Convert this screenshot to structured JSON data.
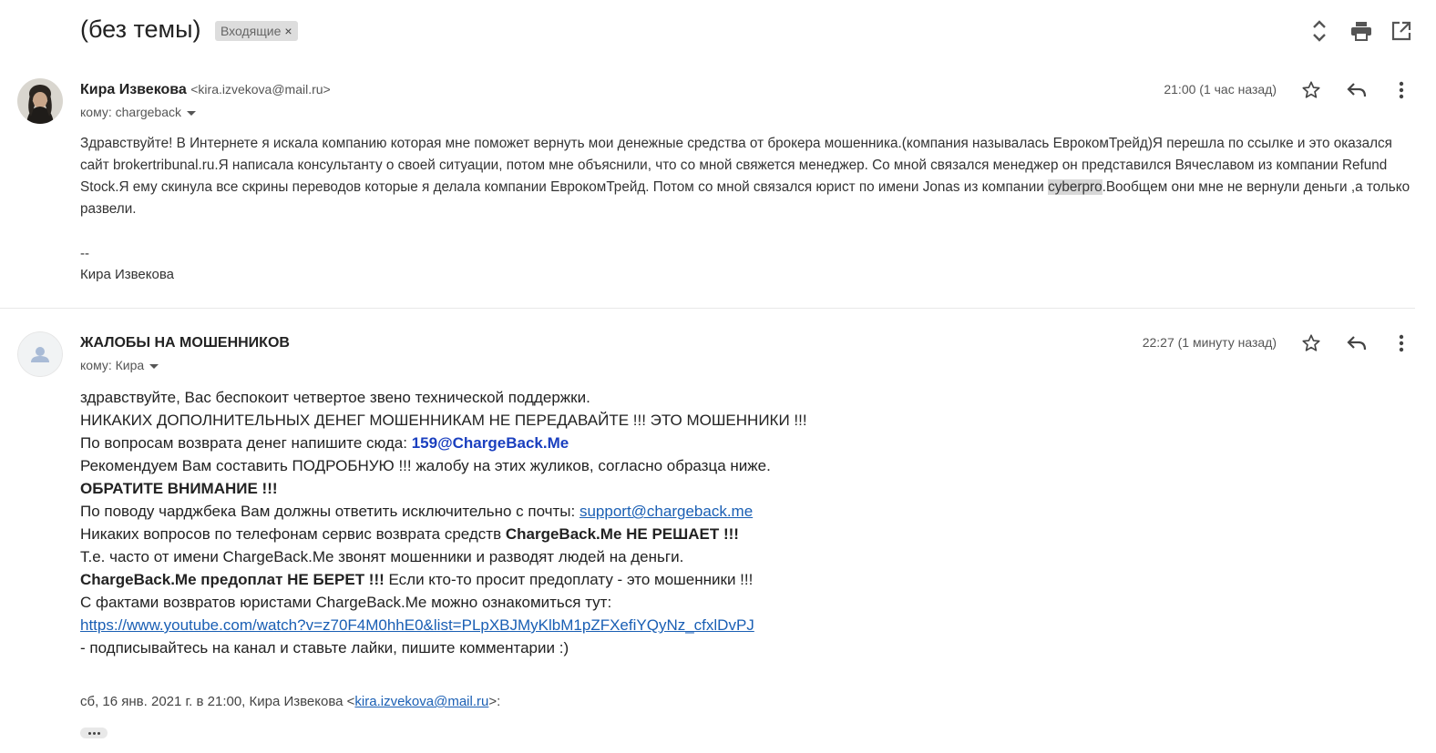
{
  "header": {
    "subject": "(без темы)",
    "label": "Входящие",
    "label_close": "×",
    "icons": [
      "expand-collapse-icon",
      "print-icon",
      "open-in-new-window-icon"
    ]
  },
  "message1": {
    "sender_name": "Кира Извекова",
    "sender_email": "<kira.izvekova@mail.ru>",
    "to": "кому: chargeback",
    "time": "21:00 (1 час назад)",
    "body_before": "Здравствуйте! В Интернете я искала компанию которая мне поможет вернуть мои денежные средства от брокера мошенника.(компания называлась ЕврокомТрейд)Я перешла по ссылке и это оказался сайт brokertribunal.ru.Я написала консультанту о своей ситуации, потом мне объяснили, что со мной свяжется менеджер. Со мной связался менеджер он представился Вячеславом из компании Refund Stock.Я ему скинула все скрины переводов которые я делала компании ЕврокомТрейд. Потом со мной связался юрист по имени Jonas из компании ",
    "body_highlight": "cyberpro",
    "body_after": ".Вообщем они мне не вернули деньги ,а только развели.",
    "sig_dash": "--",
    "sig_name": "Кира Извекова"
  },
  "message2": {
    "sender_name": "ЖАЛОБЫ НА МОШЕННИКОВ",
    "to": "кому: Кира",
    "time": "22:27 (1 минуту назад)",
    "l1": "здравствуйте, Вас беспокоит четвертое звено технической поддержки.",
    "l2": "НИКАКИХ ДОПОЛНИТЕЛЬНЫХ ДЕНЕГ МОШЕННИКАМ НЕ ПЕРЕДАВАЙТЕ !!! ЭТО МОШЕННИКИ !!!",
    "l3_text": "По вопросам возврата денег напишите сюда: ",
    "l3_email": "159@ChargeBack.Me",
    "l4": "Рекомендуем Вам составить ПОДРОБНУЮ !!! жалобу на этих жуликов, согласно образца ниже.",
    "l5": "ОБРАТИТЕ ВНИМАНИЕ !!!",
    "l6_text": "По поводу чарджбека Вам должны ответить исключительно с почты: ",
    "l6_link": "support@chargeback.me",
    "l7_text": "Никаких вопросов по телефонам сервис возврата средств ",
    "l7_bold": "ChargeBack.Me НЕ РЕШАЕТ !!!",
    "l8": "Т.е. часто от имени ChargeBack.Me звонят мошенники и разводят людей на деньги.",
    "l9_bold": "ChargeBack.Me предоплат НЕ БЕРЕТ !!!",
    "l9_text": " Если кто-то просит предоплату - это мошенники !!!",
    "l10": "С фактами возвратов юристами ChargeBack.Me можно ознакомиться тут:",
    "l11_link": "https://www.youtube.com/watch?v=z70F4M0hhE0&list=PLpXBJMyKlbM1pZFXefiYQyNz_cfxlDvPJ",
    "l12": " - подписывайтесь на канал и ставьте лайки, пишите комментарии :)",
    "quote_prefix": "сб, 16 янв. 2021 г. в 21:00, Кира Извекова <",
    "quote_email": "kira.izvekova@mail.ru",
    "quote_suffix": ">:"
  }
}
